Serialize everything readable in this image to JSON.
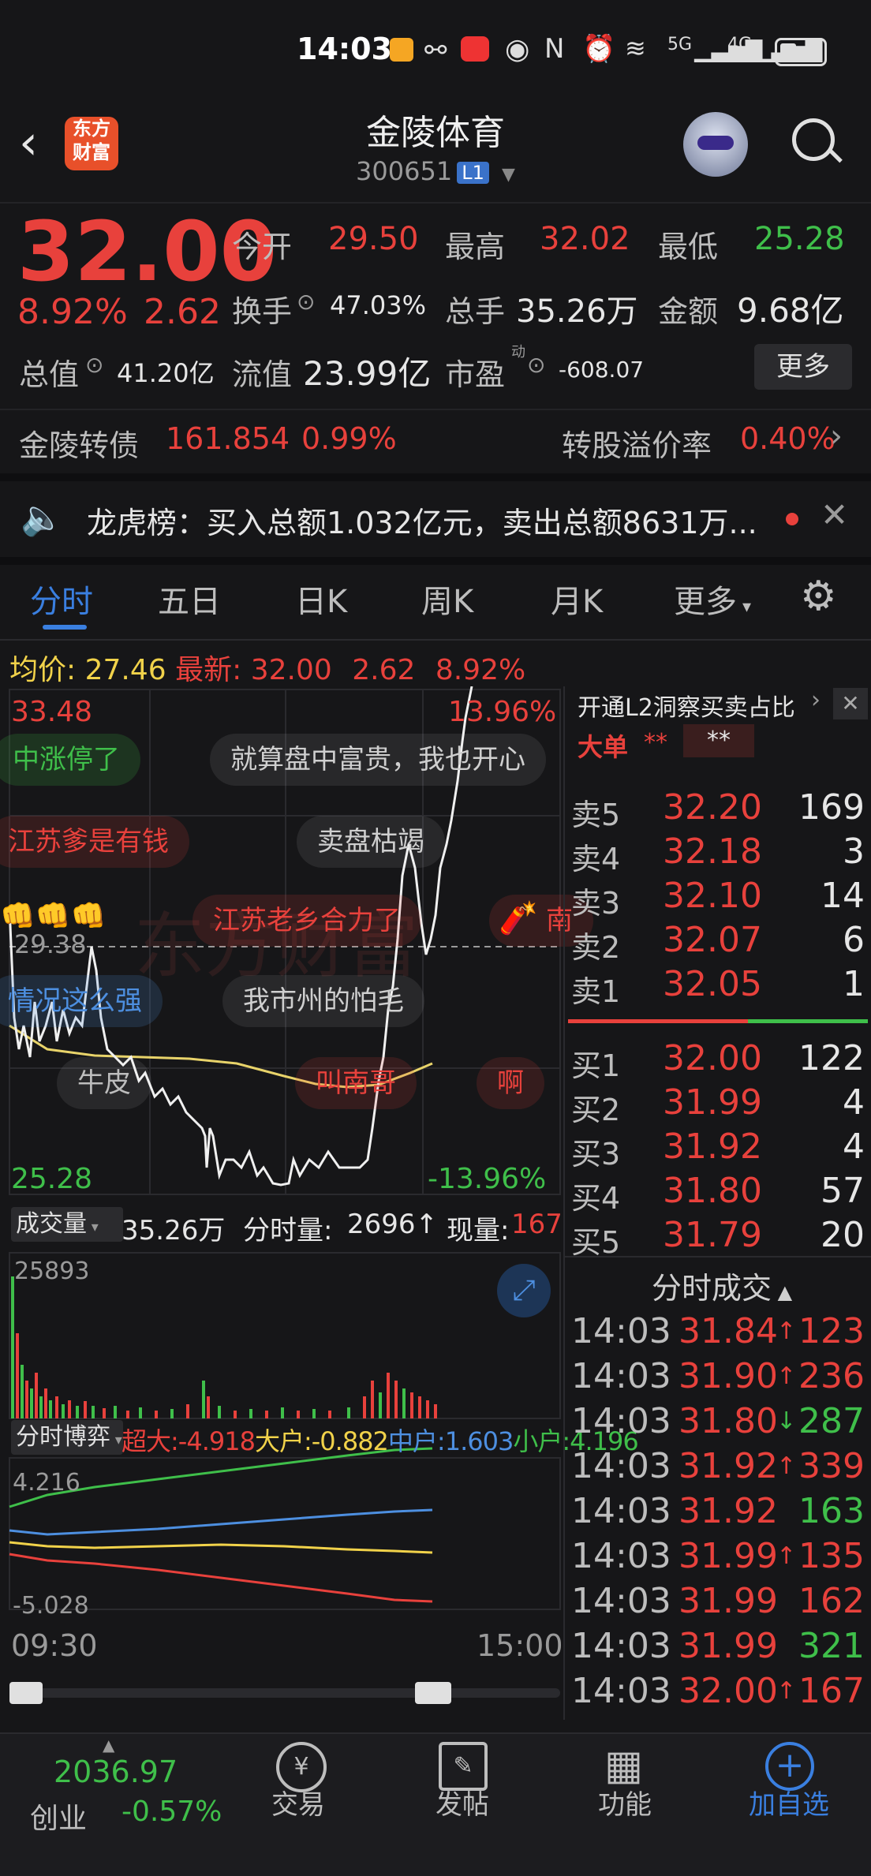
{
  "status_bar": {
    "time": "14:03",
    "network1": "5G",
    "network2": "4G"
  },
  "header": {
    "logo_text_line1": "东方",
    "logo_text_line2": "财富",
    "title": "金陵体育",
    "code": "300651",
    "level_badge": "L1"
  },
  "quote": {
    "price": "32.00",
    "change_pct": "8.92%",
    "change": "2.62",
    "open_label": "今开",
    "open": "29.50",
    "high_label": "最高",
    "high": "32.02",
    "low_label": "最低",
    "low": "25.28",
    "turnover_label": "换手",
    "turnover": "47.03%",
    "volume_label": "总手",
    "volume": "35.26万",
    "amount_label": "金额",
    "amount": "9.68亿",
    "mktcap_label": "总值",
    "mktcap": "41.20亿",
    "float_label": "流值",
    "float": "23.99亿",
    "pe_label": "市盈",
    "pe_sup": "动",
    "pe": "-608.07",
    "more_button": "更多"
  },
  "bond": {
    "name": "金陵转债",
    "price": "161.854",
    "pct": "0.99%",
    "premium_label": "转股溢价率",
    "premium": "0.40%"
  },
  "notice": {
    "text": "龙虎榜：买入总额1.032亿元，卖出总额8631万..."
  },
  "tabs": [
    "分时",
    "五日",
    "日K",
    "周K",
    "月K",
    "更多"
  ],
  "summary": {
    "avg_label": "均价:",
    "avg": "27.46",
    "latest_label": "最新:",
    "latest": "32.00",
    "change": "2.62",
    "pct": "8.92%"
  },
  "chart": {
    "top_price": "33.48",
    "top_pct": "13.96%",
    "prev_close": "29.38",
    "bottom_price": "25.28",
    "bottom_pct": "-13.96%",
    "watermark": "东方财富",
    "start_time": "09:30",
    "end_time": "15:00"
  },
  "danmaku": [
    "中涨停了",
    "就算盘中富贵，我也开心",
    "江苏爹是有钱",
    "卖盘枯竭",
    "江苏老乡合力了",
    "南",
    "情况这么强",
    "我市州的怕毛",
    "牛皮",
    "叫南哥",
    "啊"
  ],
  "volume_bar": {
    "label": "成交量",
    "total": "35.26万",
    "tick_label": "分时量:",
    "tick": "2696↑",
    "now_label": "现量:",
    "now": "167",
    "max": "25893"
  },
  "game_bar": {
    "label": "分时博弈",
    "super_label": "超大:",
    "super": "-4.918",
    "big_label": "大户:",
    "big": "-0.882",
    "mid_label": "中户:",
    "mid": "1.603",
    "small_label": "小户:",
    "small": "4.196",
    "top": "4.216",
    "bottom": "-5.028"
  },
  "l2": {
    "banner": "开通L2洞察买卖占比",
    "big_order_label": "大单",
    "big_order_val1": "**",
    "big_order_val2": "**"
  },
  "order_book": {
    "asks": [
      {
        "label": "卖5",
        "price": "32.20",
        "vol": "169"
      },
      {
        "label": "卖4",
        "price": "32.18",
        "vol": "3"
      },
      {
        "label": "卖3",
        "price": "32.10",
        "vol": "14"
      },
      {
        "label": "卖2",
        "price": "32.07",
        "vol": "6"
      },
      {
        "label": "卖1",
        "price": "32.05",
        "vol": "1"
      }
    ],
    "bids": [
      {
        "label": "买1",
        "price": "32.00",
        "vol": "122"
      },
      {
        "label": "买2",
        "price": "31.99",
        "vol": "4"
      },
      {
        "label": "买3",
        "price": "31.92",
        "vol": "4"
      },
      {
        "label": "买4",
        "price": "31.80",
        "vol": "57"
      },
      {
        "label": "买5",
        "price": "31.79",
        "vol": "20"
      }
    ]
  },
  "trades_title": "分时成交",
  "trades": [
    {
      "time": "14:03",
      "price": "31.84",
      "arrow": "↑",
      "vol": "123",
      "vol_color": "#e8413c",
      "arrow_color": "#e8413c"
    },
    {
      "time": "14:03",
      "price": "31.90",
      "arrow": "↑",
      "vol": "236",
      "vol_color": "#e8413c",
      "arrow_color": "#e8413c"
    },
    {
      "time": "14:03",
      "price": "31.80",
      "arrow": "↓",
      "vol": "287",
      "vol_color": "#3fbf4a",
      "arrow_color": "#3fbf4a"
    },
    {
      "time": "14:03",
      "price": "31.92",
      "arrow": "↑",
      "vol": "339",
      "vol_color": "#e8413c",
      "arrow_color": "#e8413c"
    },
    {
      "time": "14:03",
      "price": "31.92",
      "arrow": "",
      "vol": "163",
      "vol_color": "#3fbf4a",
      "arrow_color": "#3fbf4a"
    },
    {
      "time": "14:03",
      "price": "31.99",
      "arrow": "↑",
      "vol": "135",
      "vol_color": "#e8413c",
      "arrow_color": "#e8413c"
    },
    {
      "time": "14:03",
      "price": "31.99",
      "arrow": "",
      "vol": "162",
      "vol_color": "#e8413c",
      "arrow_color": "#e8413c"
    },
    {
      "time": "14:03",
      "price": "31.99",
      "arrow": "",
      "vol": "321",
      "vol_color": "#3fbf4a",
      "arrow_color": "#3fbf4a"
    },
    {
      "time": "14:03",
      "price": "32.00",
      "arrow": "↑",
      "vol": "167",
      "vol_color": "#e8413c",
      "arrow_color": "#e8413c"
    }
  ],
  "bottom_nav": {
    "index_value": "2036.97",
    "index_name": "创业",
    "index_pct": "-0.57%",
    "trade": "交易",
    "post": "发帖",
    "function": "功能",
    "add_watch": "加自选"
  }
}
